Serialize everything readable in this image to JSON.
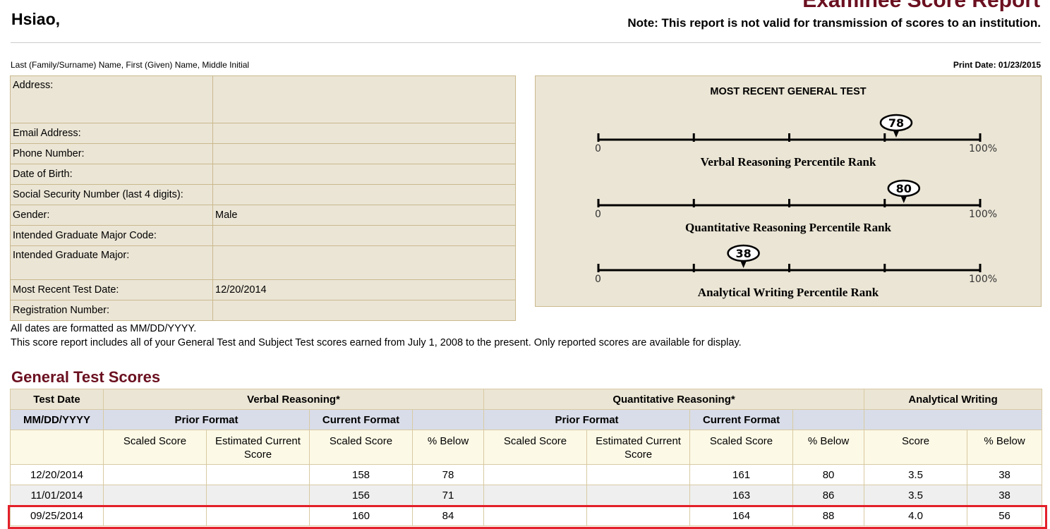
{
  "header": {
    "title": "Examinee Score Report",
    "name": "Hsiao,",
    "note": "Note: This report is not valid for transmission of scores to an institution.",
    "name_caption": "Last (Family/Surname) Name, First (Given) Name, Middle Initial",
    "print_date": "Print Date: 01/23/2015"
  },
  "info": [
    {
      "label": "Address:",
      "value": ""
    },
    {
      "label": "Email Address:",
      "value": ""
    },
    {
      "label": "Phone Number:",
      "value": ""
    },
    {
      "label": "Date of Birth:",
      "value": ""
    },
    {
      "label": "Social Security Number (last 4 digits):",
      "value": ""
    },
    {
      "label": "Gender:",
      "value": "Male"
    },
    {
      "label": "Intended Graduate Major Code:",
      "value": ""
    },
    {
      "label": "Intended Graduate Major:",
      "value": ""
    },
    {
      "label": "Most Recent Test Date:",
      "value": "12/20/2014"
    },
    {
      "label": "Registration Number:",
      "value": ""
    }
  ],
  "chart_data": {
    "type": "scatter",
    "title": "MOST RECENT GENERAL TEST",
    "xlim": [
      0,
      100
    ],
    "x_min_label": "0",
    "x_max_label": "100%",
    "ticks": [
      0,
      25,
      50,
      75,
      100
    ],
    "series": [
      {
        "name": "Verbal Reasoning Percentile Rank",
        "value": 78
      },
      {
        "name": "Quantitative Reasoning Percentile Rank",
        "value": 80
      },
      {
        "name": "Analytical Writing Percentile Rank",
        "value": 38
      }
    ]
  },
  "notes": {
    "line1": "All dates are formatted as MM/DD/YYYY.",
    "line2": "This score report includes all of your General Test and Subject Test scores earned from July 1, 2008 to the present. Only reported scores are available for display."
  },
  "scores": {
    "heading": "General Test Scores",
    "groups": {
      "test_date": "Test Date",
      "verbal": "Verbal Reasoning*",
      "quant": "Quantitative Reasoning*",
      "writing": "Analytical Writing"
    },
    "subheaders": {
      "date_format": "MM/DD/YYYY",
      "prior_format": "Prior Format",
      "current_format": "Current Format"
    },
    "columns": {
      "scaled_score": "Scaled Score",
      "estimated_current_score": "Estimated Current Score",
      "pct_below": "% Below",
      "score": "Score"
    },
    "rows": [
      {
        "date": "12/20/2014",
        "v_prior_scaled": "",
        "v_prior_est": "",
        "v_scaled": "158",
        "v_below": "78",
        "q_prior_scaled": "",
        "q_prior_est": "",
        "q_scaled": "161",
        "q_below": "80",
        "aw_score": "3.5",
        "aw_below": "38"
      },
      {
        "date": "11/01/2014",
        "v_prior_scaled": "",
        "v_prior_est": "",
        "v_scaled": "156",
        "v_below": "71",
        "q_prior_scaled": "",
        "q_prior_est": "",
        "q_scaled": "163",
        "q_below": "86",
        "aw_score": "3.5",
        "aw_below": "38"
      },
      {
        "date": "09/25/2014",
        "v_prior_scaled": "",
        "v_prior_est": "",
        "v_scaled": "160",
        "v_below": "84",
        "q_prior_scaled": "",
        "q_prior_est": "",
        "q_scaled": "164",
        "q_below": "88",
        "aw_score": "4.0",
        "aw_below": "56"
      }
    ],
    "highlighted_row": 2,
    "highlight_color": "#e3202a"
  },
  "colors": {
    "title": "#6b1020",
    "panel_bg": "#ebe5d5",
    "panel_border": "#c9b98e",
    "subheader_bg": "#d9dde9"
  }
}
